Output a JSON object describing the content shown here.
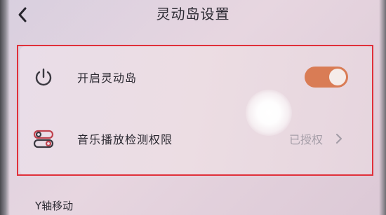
{
  "header": {
    "title": "灵动岛设置",
    "back_icon": "back-chevron-icon"
  },
  "settings": {
    "enable_island": {
      "label": "开启灵动岛",
      "icon": "power-icon",
      "toggle_on": true,
      "toggle_color": "#d97c55"
    },
    "music_permission": {
      "label": "音乐播放检测权限",
      "icon": "toggle-switches-icon",
      "status": "已授权",
      "chevron_icon": "chevron-right-icon"
    }
  },
  "sections": {
    "y_axis_label": "Y轴移动"
  },
  "colors": {
    "highlight_border": "#e0303a",
    "icon_accent": "#c0434f"
  }
}
